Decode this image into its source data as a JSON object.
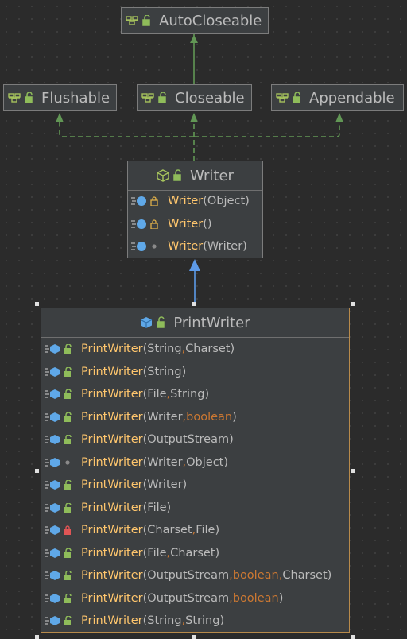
{
  "interfaces": {
    "autocloseable": "AutoCloseable",
    "flushable": "Flushable",
    "closeable": "Closeable",
    "appendable": "Appendable"
  },
  "writer": {
    "name": "Writer",
    "constructors": [
      {
        "name": "Writer",
        "visibility": "protected",
        "params": [
          "Object"
        ]
      },
      {
        "name": "Writer",
        "visibility": "protected",
        "params": []
      },
      {
        "name": "Writer",
        "visibility": "package",
        "params": [
          "Writer"
        ]
      }
    ]
  },
  "printwriter": {
    "name": "PrintWriter",
    "constructors": [
      {
        "name": "PrintWriter",
        "visibility": "public",
        "params": [
          "String",
          "Charset"
        ]
      },
      {
        "name": "PrintWriter",
        "visibility": "public",
        "params": [
          "String"
        ]
      },
      {
        "name": "PrintWriter",
        "visibility": "public",
        "params": [
          "File",
          "String"
        ]
      },
      {
        "name": "PrintWriter",
        "visibility": "public",
        "params": [
          "Writer",
          "boolean"
        ]
      },
      {
        "name": "PrintWriter",
        "visibility": "public",
        "params": [
          "OutputStream"
        ]
      },
      {
        "name": "PrintWriter",
        "visibility": "package",
        "params": [
          "Writer",
          "Object"
        ]
      },
      {
        "name": "PrintWriter",
        "visibility": "public",
        "params": [
          "Writer"
        ]
      },
      {
        "name": "PrintWriter",
        "visibility": "public",
        "params": [
          "File"
        ]
      },
      {
        "name": "PrintWriter",
        "visibility": "private",
        "params": [
          "Charset",
          "File"
        ]
      },
      {
        "name": "PrintWriter",
        "visibility": "public",
        "params": [
          "File",
          "Charset"
        ]
      },
      {
        "name": "PrintWriter",
        "visibility": "public",
        "params": [
          "OutputStream",
          "boolean",
          "Charset"
        ]
      },
      {
        "name": "PrintWriter",
        "visibility": "public",
        "params": [
          "OutputStream",
          "boolean"
        ]
      },
      {
        "name": "PrintWriter",
        "visibility": "public",
        "params": [
          "String",
          "String"
        ]
      }
    ]
  },
  "colors": {
    "background": "#2b2b2b",
    "node": "#3c3f41",
    "method_name": "#ffc66d",
    "keyword": "#cc7832",
    "extends_arrow": "#629755",
    "inherits_arrow": "#5d9ae8"
  }
}
